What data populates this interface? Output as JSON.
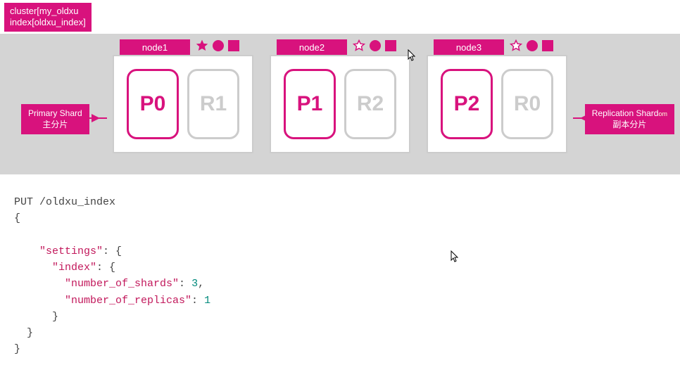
{
  "cluster_label_line1": "cluster[my_oldxu",
  "cluster_label_line2": "index[oldxu_index]",
  "primary_label_en": "Primary Shard",
  "primary_label_cn": "主分片",
  "replica_label_en": "Replication Shard",
  "replica_label_cn": "副本分片",
  "replica_label_suffix": "om",
  "nodes": [
    {
      "name": "node1",
      "star_filled": true,
      "primary_shard": "P0",
      "replica_shard": "R1"
    },
    {
      "name": "node2",
      "star_filled": false,
      "primary_shard": "P1",
      "replica_shard": "R2"
    },
    {
      "name": "node3",
      "star_filled": false,
      "primary_shard": "P2",
      "replica_shard": "R0"
    }
  ],
  "code": {
    "method": "PUT",
    "path": "/oldxu_index",
    "key_settings": "\"settings\"",
    "key_index": "\"index\"",
    "key_shards": "\"number_of_shards\"",
    "key_replicas": "\"number_of_replicas\"",
    "val_shards": "3",
    "val_replicas": "1"
  },
  "chart_data": {
    "type": "diagram",
    "cluster": "my_oldxu",
    "index": "oldxu_index",
    "nodes": [
      {
        "node": "node1",
        "master": true,
        "shards": [
          {
            "id": "P0",
            "role": "primary"
          },
          {
            "id": "R1",
            "role": "replica"
          }
        ]
      },
      {
        "node": "node2",
        "master": false,
        "shards": [
          {
            "id": "P1",
            "role": "primary"
          },
          {
            "id": "R2",
            "role": "replica"
          }
        ]
      },
      {
        "node": "node3",
        "master": false,
        "shards": [
          {
            "id": "P2",
            "role": "primary"
          },
          {
            "id": "R0",
            "role": "replica"
          }
        ]
      }
    ],
    "settings": {
      "number_of_shards": 3,
      "number_of_replicas": 1
    }
  }
}
